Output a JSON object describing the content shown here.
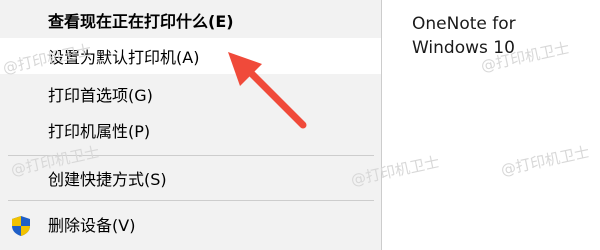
{
  "context_menu": {
    "items": [
      {
        "label": "查看现在正在打印什么(E)"
      },
      {
        "label": "设置为默认打印机(A)"
      },
      {
        "label": "打印首选项(G)"
      },
      {
        "label": "打印机属性(P)"
      },
      {
        "label": "创建快捷方式(S)"
      },
      {
        "label": "删除设备(V)"
      }
    ]
  },
  "device": {
    "name_line1": "OneNote for",
    "name_line2": "Windows 10"
  },
  "watermark": {
    "text": "@打印机卫士"
  },
  "colors": {
    "menu_bg": "#f2f2f2",
    "hover_bg": "#ffffff",
    "separator": "#cdcdcd",
    "arrow": "#f04a3a",
    "shield_blue": "#1f5fc7",
    "shield_yellow": "#f2c200"
  }
}
